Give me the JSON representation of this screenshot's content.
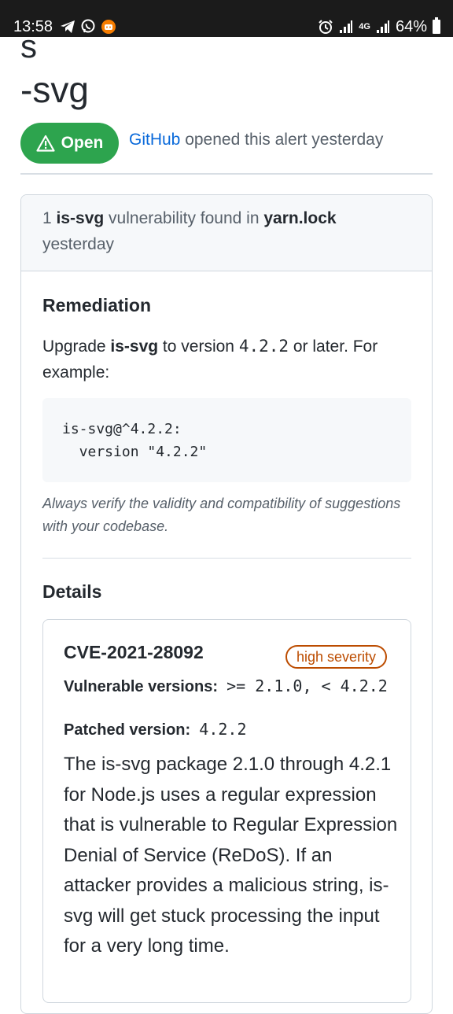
{
  "status_bar": {
    "time": "13:58",
    "battery": "64%",
    "network": "4G",
    "icons": [
      "telegram-icon",
      "viber-icon",
      "notification-app-icon",
      "alarm-icon",
      "signal-icon",
      "signal-icon",
      "battery-icon"
    ]
  },
  "title": {
    "line1": "s",
    "line2": "-svg"
  },
  "alert": {
    "state_label": "Open",
    "opener": "GitHub",
    "meta_text": " opened this alert yesterday"
  },
  "card": {
    "header": {
      "count": "1 ",
      "package": "is-svg",
      "mid_text": " vulnerability found in ",
      "file": "yarn.lock",
      "time": "yesterday"
    },
    "remediation": {
      "heading": "Remediation",
      "text_prefix": "Upgrade ",
      "package": "is-svg",
      "text_mid": " to version ",
      "version": "4.2.2",
      "text_suffix": " or later. For example:",
      "code_line1": "is-svg@^4.2.2:",
      "code_line2": "  version \"4.2.2\"",
      "note": "Always verify the validity and compatibility of suggestions with your codebase."
    },
    "details": {
      "heading": "Details",
      "cve": "CVE-2021-28092",
      "severity": "high severity",
      "vulnerable_label": "Vulnerable versions:",
      "vulnerable_value": ">= 2.1.0, < 4.2.2",
      "patched_label": "Patched version:",
      "patched_value": "4.2.2",
      "description": "The is-svg package 2.1.0 through 4.2.1 for Node.js uses a regular expression that is vulnerable to Regular Expression Denial of Service (ReDoS). If an attacker provides a malicious string, is-svg will get stuck processing the input for a very long time."
    }
  },
  "colors": {
    "open_green": "#2da44e",
    "link_blue": "#0969da",
    "severity_orange": "#bc4c00",
    "status_bar_bg": "#1b1b1b"
  }
}
